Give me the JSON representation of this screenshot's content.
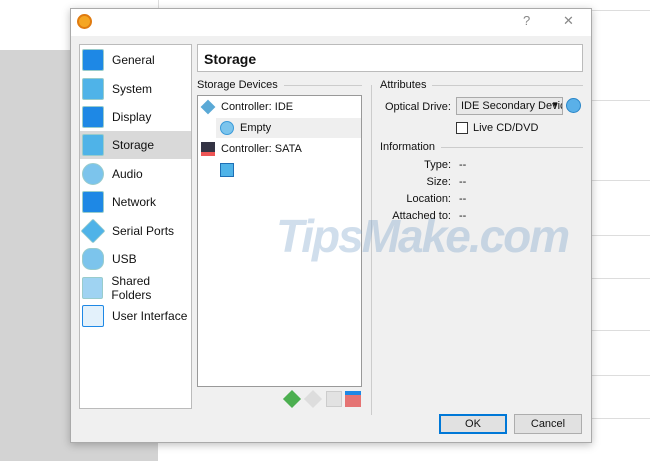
{
  "dialog": {
    "help": "?",
    "close": "✕"
  },
  "sidebar": {
    "items": [
      {
        "label": "General",
        "color": "#1e88e5"
      },
      {
        "label": "System",
        "color": "#4fb3e8"
      },
      {
        "label": "Display",
        "color": "#1e88e5"
      },
      {
        "label": "Storage",
        "color": "#4fb3e8"
      },
      {
        "label": "Audio",
        "color": "#7cc4ec"
      },
      {
        "label": "Network",
        "color": "#1e88e5"
      },
      {
        "label": "Serial Ports",
        "color": "#4fb3e8"
      },
      {
        "label": "USB",
        "color": "#7cc4ec"
      },
      {
        "label": "Shared Folders",
        "color": "#9fd3f2"
      },
      {
        "label": "User Interface",
        "color": "#c7e3f5"
      }
    ],
    "selected": "Storage"
  },
  "header": {
    "title": "Storage"
  },
  "storage_devices": {
    "label": "Storage Devices",
    "tree": {
      "ide": "Controller: IDE",
      "ide_child": "Empty",
      "sata": "Controller: SATA"
    }
  },
  "attributes": {
    "label": "Attributes",
    "optical_drive_label": "Optical Drive:",
    "optical_drive_value": "IDE Secondary Devic",
    "live_cd_label": "Live CD/DVD",
    "live_cd_checked": false
  },
  "information": {
    "label": "Information",
    "rows": [
      {
        "label": "Type:",
        "value": "--"
      },
      {
        "label": "Size:",
        "value": "--"
      },
      {
        "label": "Location:",
        "value": "--"
      },
      {
        "label": "Attached to:",
        "value": "--"
      }
    ]
  },
  "buttons": {
    "ok": "OK",
    "cancel": "Cancel"
  },
  "watermark": "TipsMake.com"
}
